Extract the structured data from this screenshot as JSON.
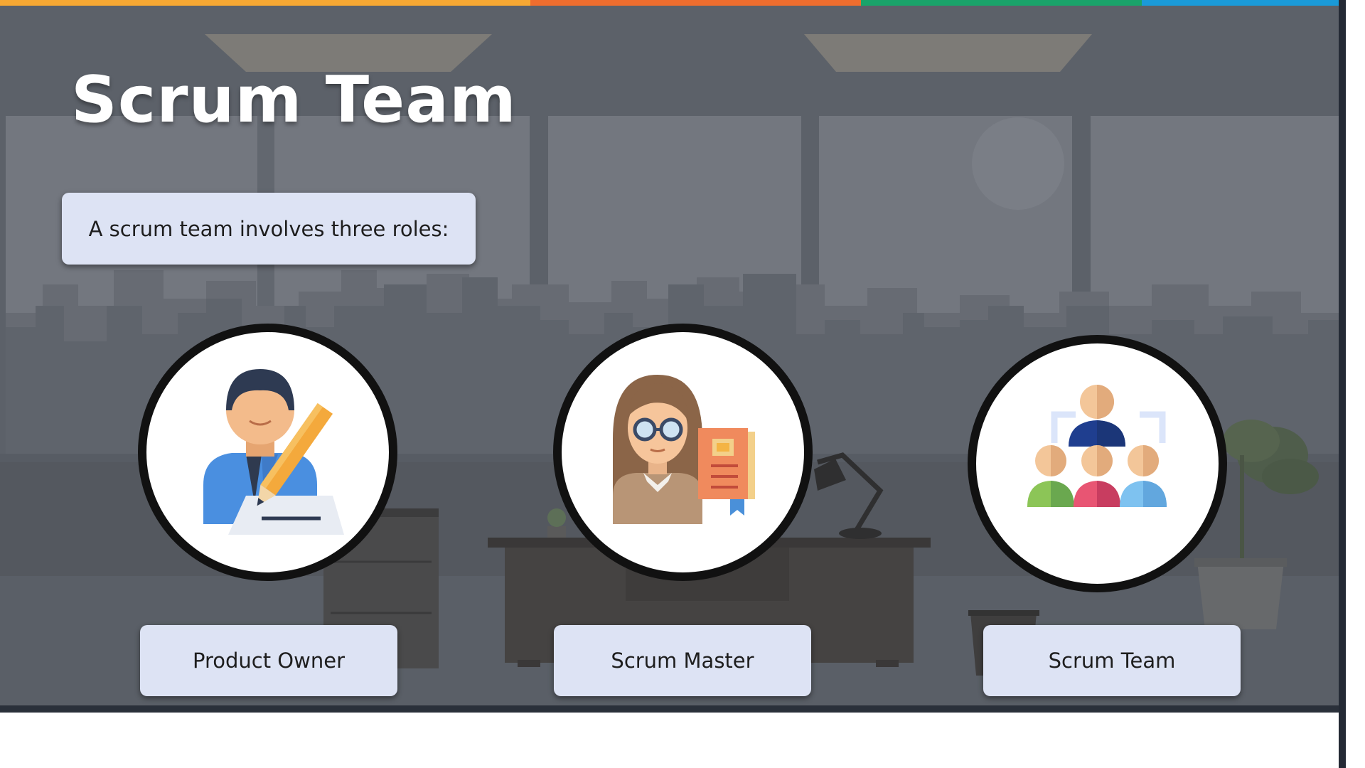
{
  "slide": {
    "title": "Scrum Team",
    "intro_text": "A scrum team involves three roles:"
  },
  "roles": [
    {
      "label": "Product Owner",
      "icon": "product-owner-icon"
    },
    {
      "label": "Scrum Master",
      "icon": "scrum-master-icon"
    },
    {
      "label": "Scrum Team",
      "icon": "scrum-team-icon"
    }
  ],
  "colors": {
    "top_stripe": [
      "#f7a833",
      "#ee6d2e",
      "#1aa36a",
      "#1a9ad8"
    ],
    "background": "#5d626a",
    "label_box": "#dde3f4"
  }
}
